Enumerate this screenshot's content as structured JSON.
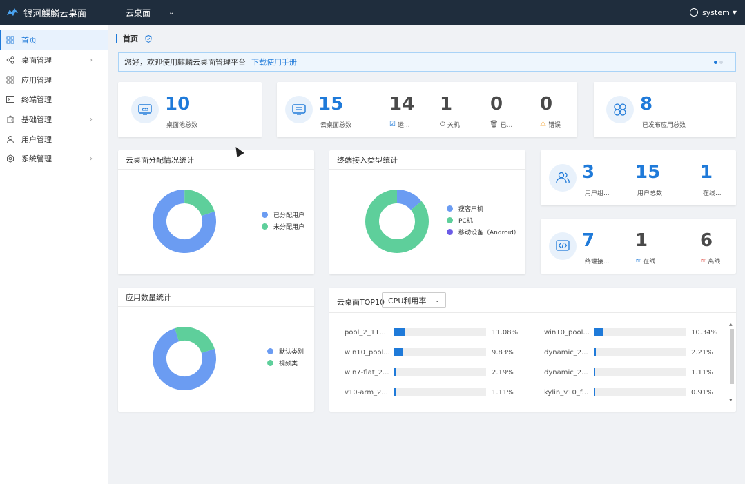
{
  "header": {
    "brand": "银河麒麟云桌面",
    "nav_label": "云桌面",
    "user": "system"
  },
  "sidebar": {
    "items": [
      {
        "label": "首页",
        "icon": "grid-icon",
        "active": true,
        "chevron": false
      },
      {
        "label": "桌面管理",
        "icon": "share-icon",
        "active": false,
        "chevron": true
      },
      {
        "label": "应用管理",
        "icon": "apps-icon",
        "active": false,
        "chevron": false
      },
      {
        "label": "终端管理",
        "icon": "terminal-icon",
        "active": false,
        "chevron": false
      },
      {
        "label": "基础管理",
        "icon": "puzzle-icon",
        "active": false,
        "chevron": true
      },
      {
        "label": "用户管理",
        "icon": "user-icon",
        "active": false,
        "chevron": false
      },
      {
        "label": "系统管理",
        "icon": "gear-icon",
        "active": false,
        "chevron": true
      }
    ]
  },
  "breadcrumb": {
    "label": "首页"
  },
  "welcome": {
    "text": "您好，欢迎使用麒麟云桌面管理平台",
    "link": "下载使用手册"
  },
  "stats": {
    "pool": {
      "value": "10",
      "label": "桌面池总数"
    },
    "desktops": {
      "value": "15",
      "label": "云桌面总数"
    },
    "running": {
      "value": "14",
      "label": "运..."
    },
    "shutdown": {
      "value": "1",
      "label": "关机"
    },
    "deleted": {
      "value": "0",
      "label": "已..."
    },
    "error": {
      "value": "0",
      "label": "错误"
    },
    "apps": {
      "value": "8",
      "label": "已发布应用总数"
    },
    "user_groups": {
      "value": "3",
      "label": "用户组..."
    },
    "users": {
      "value": "15",
      "label": "用户总数"
    },
    "online_users": {
      "value": "1",
      "label": "在线..."
    },
    "terminals": {
      "value": "7",
      "label": "终端接..."
    },
    "online": {
      "value": "1",
      "label": "在线"
    },
    "offline": {
      "value": "6",
      "label": "离线"
    }
  },
  "panels": {
    "alloc_title": "云桌面分配情况统计",
    "terminal_title": "终端接入类型统计",
    "apps_title": "应用数量统计",
    "top_title": "云桌面TOP10",
    "top_select": "CPU利用率"
  },
  "colors": {
    "blue": "#6b9cf2",
    "green": "#5ecf9b",
    "purple": "#6b5be6",
    "accent": "#1f7ad9"
  },
  "chart_data": [
    {
      "type": "pie",
      "legend": [
        "已分配用户",
        "未分配用户"
      ],
      "values": [
        80,
        20
      ]
    },
    {
      "type": "pie",
      "legend": [
        "瘦客户机",
        "PC机",
        "移动设备（Android）"
      ],
      "values": [
        14,
        86,
        0
      ]
    },
    {
      "type": "pie",
      "legend": [
        "默认类别",
        "视频类"
      ],
      "values": [
        75,
        25
      ]
    },
    {
      "type": "bar",
      "categories": [
        "pool_2_11...",
        "win10_pool...",
        "win7-flat_2...",
        "v10-arm_2...",
        "win10_pool...",
        "dynamic_2...",
        "dynamic_2...",
        "kylin_v10_f..."
      ],
      "values": [
        11.08,
        9.83,
        2.19,
        1.11,
        10.34,
        2.21,
        1.11,
        0.91
      ],
      "labels": [
        "11.08%",
        "9.83%",
        "2.19%",
        "1.11%",
        "10.34%",
        "2.21%",
        "1.11%",
        "0.91%"
      ]
    }
  ]
}
